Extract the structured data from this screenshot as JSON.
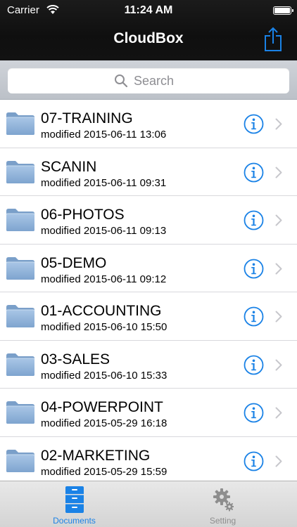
{
  "status_bar": {
    "carrier": "Carrier",
    "time": "11:24 AM"
  },
  "nav": {
    "title": "CloudBox",
    "share_icon": "share-icon"
  },
  "search": {
    "placeholder": "Search"
  },
  "files": [
    {
      "name": "07-TRAINING",
      "modified": "modified 2015-06-11 13:06"
    },
    {
      "name": "SCANIN",
      "modified": "modified 2015-06-11 09:31"
    },
    {
      "name": "06-PHOTOS",
      "modified": "modified 2015-06-11 09:13"
    },
    {
      "name": "05-DEMO",
      "modified": "modified 2015-06-11 09:12"
    },
    {
      "name": "01-ACCOUNTING",
      "modified": "modified 2015-06-10 15:50"
    },
    {
      "name": "03-SALES",
      "modified": "modified 2015-06-10 15:33"
    },
    {
      "name": "04-POWERPOINT",
      "modified": "modified 2015-05-29 16:18"
    },
    {
      "name": "02-MARKETING",
      "modified": "modified 2015-05-29 15:59"
    }
  ],
  "tabs": [
    {
      "label": "Documents",
      "icon": "cabinet-icon",
      "selected": true
    },
    {
      "label": "Setting",
      "icon": "gear-icon",
      "selected": false
    }
  ],
  "colors": {
    "accent": "#1a82e6",
    "folder": "#8fb3dc",
    "header": "#121212"
  }
}
